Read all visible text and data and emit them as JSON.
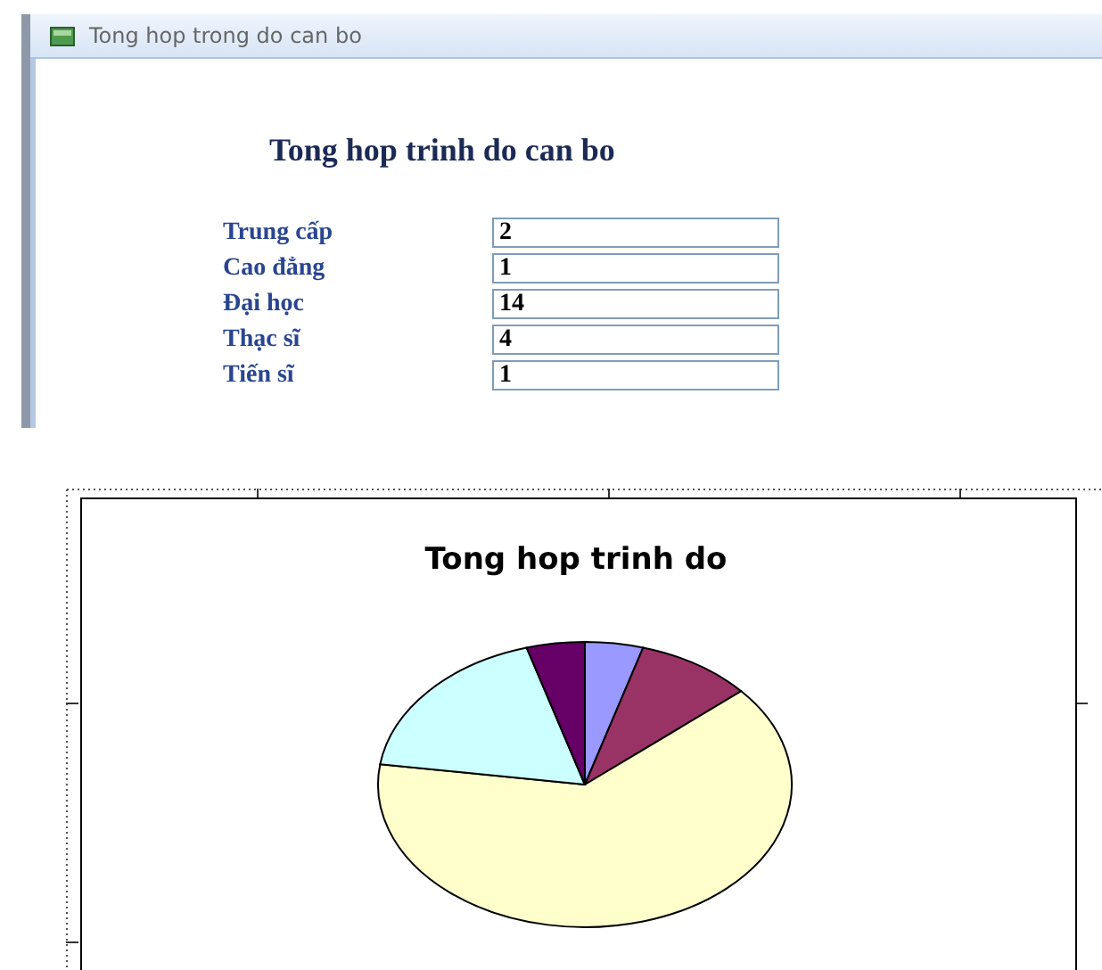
{
  "window": {
    "title": "Tong hop trong do can bo"
  },
  "form": {
    "heading": "Tong hop trinh do can bo",
    "fields": [
      {
        "label": "Trung cấp",
        "value": "2"
      },
      {
        "label": "Cao đẳng",
        "value": "1"
      },
      {
        "label": "Đại học",
        "value": "14"
      },
      {
        "label": "Thạc sĩ",
        "value": "4"
      },
      {
        "label": "Tiến sĩ",
        "value": "1"
      }
    ]
  },
  "chart": {
    "title": "Tong hop trinh do"
  }
}
